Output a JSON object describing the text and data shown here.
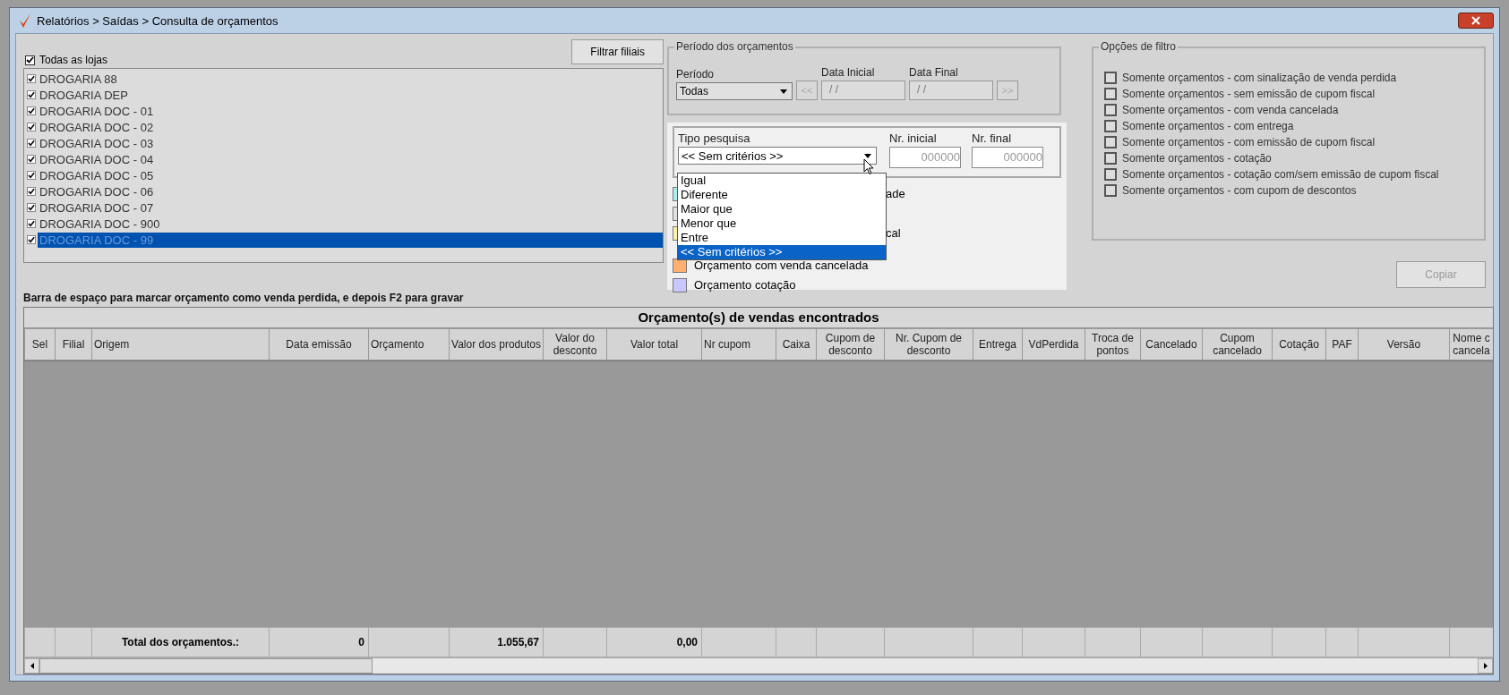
{
  "window": {
    "title": "Relatórios > Saídas > Consulta de orçamentos"
  },
  "stores": {
    "all": {
      "label": "Todas as lojas",
      "checked": true
    },
    "filter_button": "Filtrar filiais",
    "items": [
      {
        "label": "DROGARIA 88",
        "checked": true,
        "selected": false
      },
      {
        "label": "DROGARIA DEP",
        "checked": true,
        "selected": false
      },
      {
        "label": "DROGARIA DOC - 01",
        "checked": true,
        "selected": false
      },
      {
        "label": "DROGARIA DOC - 02",
        "checked": true,
        "selected": false
      },
      {
        "label": "DROGARIA DOC - 03",
        "checked": true,
        "selected": false
      },
      {
        "label": "DROGARIA DOC - 04",
        "checked": true,
        "selected": false
      },
      {
        "label": "DROGARIA DOC - 05",
        "checked": true,
        "selected": false
      },
      {
        "label": "DROGARIA DOC - 06",
        "checked": true,
        "selected": false
      },
      {
        "label": "DROGARIA DOC - 07",
        "checked": true,
        "selected": false
      },
      {
        "label": "DROGARIA DOC - 900",
        "checked": true,
        "selected": false
      },
      {
        "label": "DROGARIA DOC - 99",
        "checked": true,
        "selected": true
      }
    ]
  },
  "period": {
    "title": "Período dos orçamentos",
    "period_label": "Período",
    "period_value": "Todas",
    "start_label": "Data Inicial",
    "start_value": "/ /",
    "end_label": "Data Final",
    "end_value": "/ /",
    "prev_button": "<<",
    "next_button": ">>",
    "disabled": true
  },
  "search": {
    "type_label": "Tipo pesquisa",
    "type_value": "<< Sem critérios >>",
    "expanded": true,
    "options": [
      {
        "label": "Igual",
        "selected": false
      },
      {
        "label": "Diferente",
        "selected": false
      },
      {
        "label": "Maior que",
        "selected": false
      },
      {
        "label": "Menor que",
        "selected": false
      },
      {
        "label": "Entre",
        "selected": false
      },
      {
        "label": "<< Sem critérios >>",
        "selected": true
      }
    ],
    "start_label": "Nr. inicial",
    "start_value": "000000",
    "end_label": "Nr. final",
    "end_value": "000000"
  },
  "legend": [
    {
      "kind": "clipped",
      "color": "#a8eef0",
      "text": "ade"
    },
    {
      "kind": "clipped",
      "color": "#e2e2e2"
    },
    {
      "kind": "clipped",
      "color": "#fff2a8",
      "text": "cal"
    },
    {
      "kind": "full",
      "color": "#ffb070",
      "text": "Orçamento com venda cancelada"
    },
    {
      "kind": "full",
      "color": "#c8c8ff",
      "text": "Orçamento cotação"
    }
  ],
  "filter_options": {
    "title": "Opções de filtro",
    "items": [
      {
        "label": "Somente orçamentos - com sinalização de venda perdida",
        "checked": false
      },
      {
        "label": "Somente orçamentos - sem emissão de cupom fiscal",
        "checked": false
      },
      {
        "label": "Somente orçamentos - com venda cancelada",
        "checked": false
      },
      {
        "label": "Somente orçamentos - com entrega",
        "checked": false
      },
      {
        "label": "Somente orçamentos - com emissão de cupom fiscal",
        "checked": false
      },
      {
        "label": "Somente orçamentos - cotação",
        "checked": false
      },
      {
        "label": "Somente orçamentos - cotação com/sem emissão de cupom fiscal",
        "checked": false
      },
      {
        "label": "Somente orçamentos - com cupom de descontos",
        "checked": false
      }
    ]
  },
  "copy_button": {
    "label": "Copiar",
    "disabled": true
  },
  "hint": "Barra de espaço para marcar orçamento como venda perdida, e depois F2 para gravar",
  "table": {
    "title": "Orçamento(s) de vendas encontrados",
    "columns": [
      {
        "label": "Sel"
      },
      {
        "label": "Filial"
      },
      {
        "label": "Origem",
        "total": "Total dos orçamentos.:"
      },
      {
        "label": "Data emissão",
        "total": "0"
      },
      {
        "label": "Orçamento"
      },
      {
        "label": "Valor dos produtos",
        "total": "1.055,67"
      },
      {
        "label": "Valor do desconto"
      },
      {
        "label": "Valor total",
        "total": "0,00"
      },
      {
        "label": "Nr cupom"
      },
      {
        "label": "Caixa"
      },
      {
        "label": "Cupom de desconto"
      },
      {
        "label": "Nr. Cupom de desconto"
      },
      {
        "label": "Entrega"
      },
      {
        "label": "VdPerdida"
      },
      {
        "label": "Troca de pontos"
      },
      {
        "label": "Cancelado"
      },
      {
        "label": "Cupom cancelado"
      },
      {
        "label": "Cotação"
      },
      {
        "label": "PAF"
      },
      {
        "label": "Versão"
      },
      {
        "label": "Nome c cancela"
      }
    ]
  }
}
